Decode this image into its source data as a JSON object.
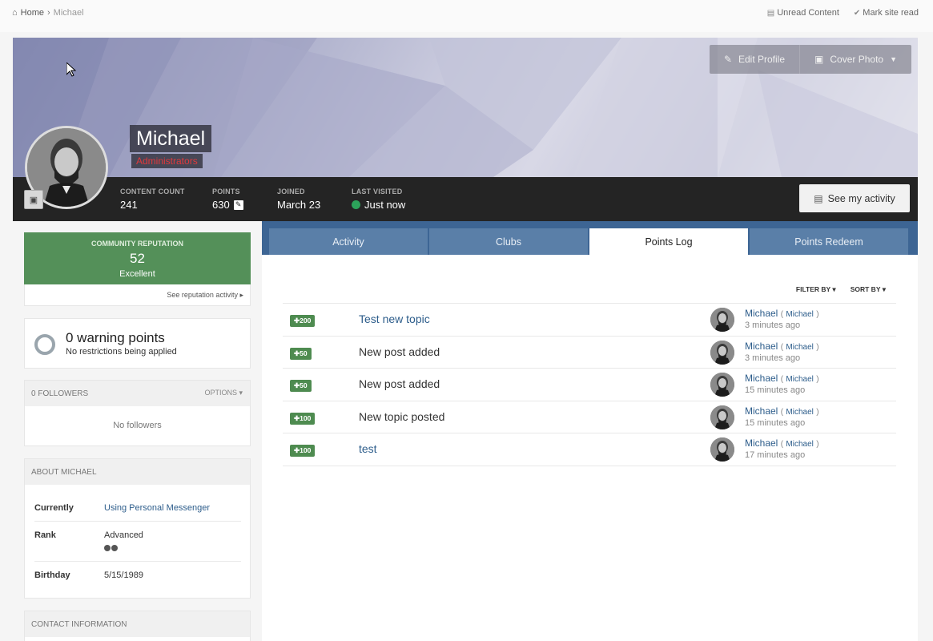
{
  "breadcrumb": {
    "home": "Home",
    "separator": "›",
    "current": "Michael"
  },
  "toplinks": {
    "unread": "Unread Content",
    "mark_read": "Mark site read"
  },
  "cover": {
    "edit_profile": "Edit Profile",
    "cover_photo": "Cover Photo"
  },
  "profile": {
    "name": "Michael",
    "group": "Administrators"
  },
  "stats": [
    {
      "label": "CONTENT COUNT",
      "value": "241"
    },
    {
      "label": "POINTS",
      "value": "630"
    },
    {
      "label": "JOINED",
      "value": "March 23"
    },
    {
      "label": "LAST VISITED",
      "value": "Just now"
    }
  ],
  "see_activity": "See my activity",
  "tabs": [
    "Activity",
    "Clubs",
    "Points Log",
    "Points Redeem"
  ],
  "active_tab": "Points Log",
  "filters": {
    "filter_by": "FILTER BY",
    "sort_by": "SORT BY"
  },
  "points_log": [
    {
      "points": "200",
      "title": "Test new topic",
      "is_link": true,
      "user": "Michael",
      "user_paren": "Michael",
      "time": "3 minutes ago"
    },
    {
      "points": "50",
      "title": "New post added",
      "is_link": false,
      "user": "Michael",
      "user_paren": "Michael",
      "time": "3 minutes ago"
    },
    {
      "points": "50",
      "title": "New post added",
      "is_link": false,
      "user": "Michael",
      "user_paren": "Michael",
      "time": "15 minutes ago"
    },
    {
      "points": "100",
      "title": "New topic posted",
      "is_link": false,
      "user": "Michael",
      "user_paren": "Michael",
      "time": "15 minutes ago"
    },
    {
      "points": "100",
      "title": "test",
      "is_link": true,
      "user": "Michael",
      "user_paren": "Michael",
      "time": "17 minutes ago"
    }
  ],
  "reputation": {
    "label": "COMMUNITY REPUTATION",
    "value": "52",
    "word": "Excellent",
    "link": "See reputation activity"
  },
  "warnings": {
    "title": "0 warning points",
    "subtitle": "No restrictions being applied"
  },
  "followers": {
    "heading": "0 FOLLOWERS",
    "options": "OPTIONS",
    "empty": "No followers"
  },
  "about": {
    "heading": "ABOUT MICHAEL",
    "currently_label": "Currently",
    "currently_value": "Using Personal Messenger",
    "rank_label": "Rank",
    "rank_value": "Advanced",
    "birthday_label": "Birthday",
    "birthday_value": "5/15/1989"
  },
  "contact": {
    "heading": "CONTACT INFORMATION"
  },
  "colors": {
    "accent": "#3d6594",
    "reputation": "#549059",
    "badge": "#4e8b50",
    "online": "#2ca35a",
    "group": "#e0393c"
  }
}
